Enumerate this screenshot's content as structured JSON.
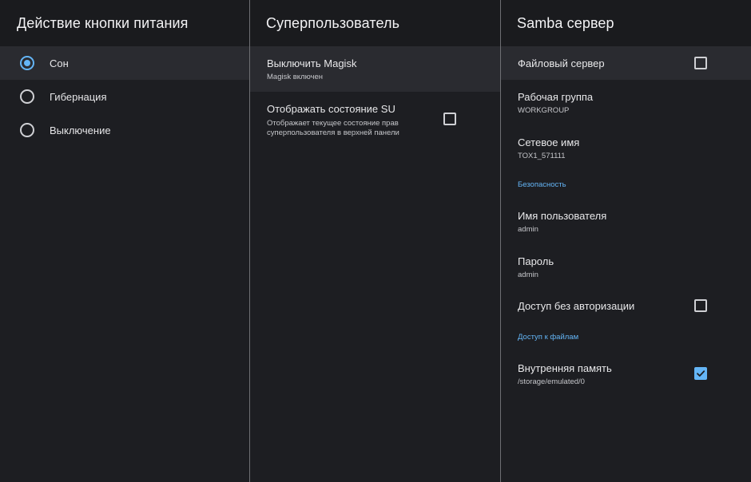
{
  "power_panel": {
    "title": "Действие кнопки питания",
    "options": [
      {
        "label": "Сон",
        "selected": true
      },
      {
        "label": "Гибернация",
        "selected": false
      },
      {
        "label": "Выключение",
        "selected": false
      }
    ]
  },
  "su_panel": {
    "title": "Суперпользователь",
    "items": [
      {
        "title": "Выключить Magisk",
        "summary": "Magisk включен"
      },
      {
        "title": "Отображать состояние SU",
        "summary_line1": "Отображает текущее состояние прав",
        "summary_line2": "суперпользователя в верхней панели",
        "checked": false
      }
    ]
  },
  "samba_panel": {
    "title": "Samba сервер",
    "file_server": {
      "title": "Файловый сервер",
      "checked": false
    },
    "workgroup": {
      "title": "Рабочая группа",
      "value": "WORKGROUP"
    },
    "network_name": {
      "title": "Сетевое имя",
      "value": "TOX1_571111"
    },
    "security_section": "Безопасность",
    "username": {
      "title": "Имя пользователя",
      "value": "admin"
    },
    "password": {
      "title": "Пароль",
      "value": "admin"
    },
    "guest_access": {
      "title": "Доступ без авторизации",
      "checked": false
    },
    "file_access_section": "Доступ к файлам",
    "internal_storage": {
      "title": "Внутренняя память",
      "value": "/storage/emulated/0",
      "checked": true
    }
  },
  "colors": {
    "background": "#1d1e22",
    "highlight": "#2a2b30",
    "accent": "#64b5f6",
    "divider": "#6e6f73"
  }
}
